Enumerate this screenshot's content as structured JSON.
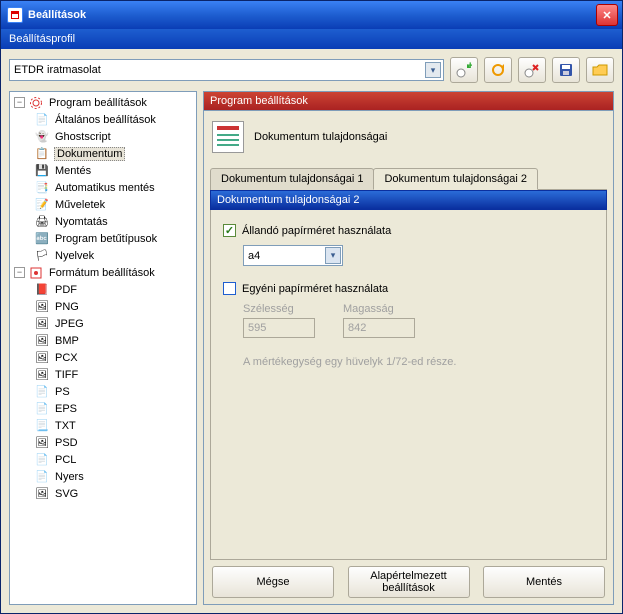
{
  "window": {
    "title": "Beállítások",
    "subheader": "Beállításprofil"
  },
  "profile": {
    "selected": "ETDR iratmasolat"
  },
  "tree": {
    "root1": "Program beállítások",
    "root2": "Formátum beállítások",
    "r1_children": {
      "c0": "Általános beállítások",
      "c1": "Ghostscript",
      "c2": "Dokumentum",
      "c3": "Mentés",
      "c4": "Automatikus mentés",
      "c5": "Műveletek",
      "c6": "Nyomtatás",
      "c7": "Program betűtípusok",
      "c8": "Nyelvek"
    },
    "r2_children": {
      "f0": "PDF",
      "f1": "PNG",
      "f2": "JPEG",
      "f3": "BMP",
      "f4": "PCX",
      "f5": "TIFF",
      "f6": "PS",
      "f7": "EPS",
      "f8": "TXT",
      "f9": "PSD",
      "f10": "PCL",
      "f11": "Nyers",
      "f12": "SVG"
    }
  },
  "right": {
    "section_header": "Program beállítások",
    "doc_title": "Dokumentum tulajdonságai",
    "tabs": {
      "t1": "Dokumentum tulajdonságai 1",
      "t2": "Dokumentum tulajdonságai 2"
    },
    "panel_header": "Dokumentum tulajdonságai 2",
    "fixed_paper_label": "Állandó papírméret használata",
    "paper_size": "a4",
    "custom_paper_label": "Egyéni papírméret használata",
    "width_label": "Szélesség",
    "height_label": "Magasság",
    "width_value": "595",
    "height_value": "842",
    "hint": "A mértékegység egy hüvelyk 1/72-ed része."
  },
  "buttons": {
    "cancel": "Mégse",
    "defaults": "Alapértelmezett beállítások",
    "save": "Mentés"
  }
}
